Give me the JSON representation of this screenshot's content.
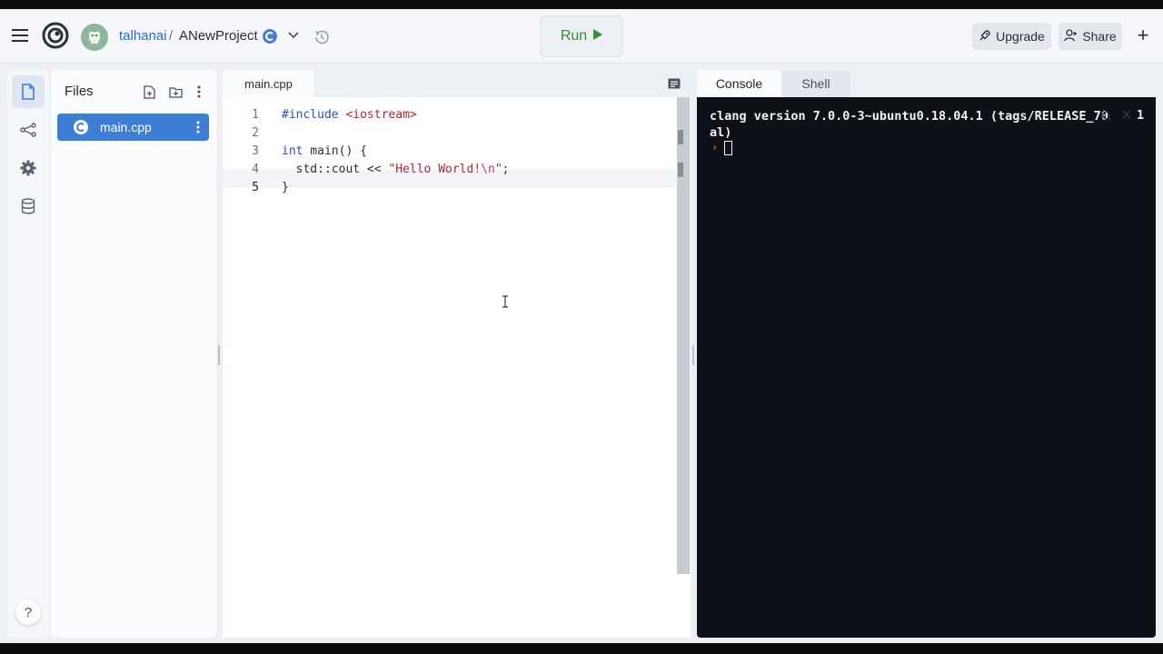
{
  "header": {
    "owner": "talhanai",
    "separator": "/",
    "project": "ANewProject",
    "run_label": "Run",
    "upgrade_label": "Upgrade",
    "share_label": "Share",
    "plus": "+"
  },
  "files_panel": {
    "title": "Files",
    "items": [
      {
        "label": "main.cpp",
        "icon": "cpp-file-icon"
      }
    ]
  },
  "editor": {
    "tab_label": "main.cpp",
    "line_numbers": [
      "1",
      "2",
      "3",
      "4",
      "5"
    ],
    "active_line": 5,
    "lines": [
      "#include <iostream>",
      "",
      "int main() {",
      "  std::cout << \"Hello World!\\n\";",
      "}"
    ]
  },
  "console": {
    "tabs": [
      "Console",
      "Shell"
    ],
    "output_line1": "clang version 7.0.0-3~ubuntu0.18.04.1 (tags/RELEASE_70",
    "output_line2": "al)",
    "trailing_char": "1",
    "prompt": "›"
  },
  "help": "?",
  "colors": {
    "accent": "#3c7ed8",
    "run_green": "#3a8a3a",
    "console_bg": "#0d1117",
    "prompt_orange": "#e07a2f"
  }
}
